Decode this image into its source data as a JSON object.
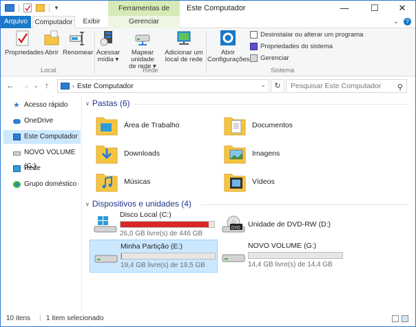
{
  "titlebar": {
    "context_tab": "Ferramentas de Unidade",
    "title": "Este Computador",
    "minimize": "—",
    "maximize": "☐",
    "close": "✕"
  },
  "tabs": {
    "file": "Arquivo",
    "computer": "Computador",
    "view": "Exibir",
    "manage": "Gerenciar"
  },
  "ribbon": {
    "local": {
      "label": "Local",
      "properties": "Propriedades",
      "open": "Abrir",
      "rename": "Renomear"
    },
    "network": {
      "label": "Rede",
      "access_media_1": "Acessar",
      "access_media_2": "mídia ▾",
      "map_drive_1": "Mapear unidade",
      "map_drive_2": "de rede ▾",
      "add_location_1": "Adicionar um",
      "add_location_2": "local de rede"
    },
    "system": {
      "label": "Sistema",
      "open_settings_1": "Abrir",
      "open_settings_2": "Configurações",
      "uninstall": "Desinstalar ou alterar um programa",
      "system_props": "Propriedades do sistema",
      "manage": "Gerenciar"
    }
  },
  "address": {
    "path": "Este Computador",
    "search_placeholder": "Pesquisar Este Computador"
  },
  "navpane": {
    "items": [
      {
        "label": "Acesso rápido",
        "icon": "star-icon"
      },
      {
        "label": "OneDrive",
        "icon": "cloud-icon"
      },
      {
        "label": "Este Computador",
        "icon": "computer-icon"
      },
      {
        "label": "NOVO VOLUME (G:)",
        "icon": "drive-icon"
      },
      {
        "label": "Rede",
        "icon": "network-icon"
      },
      {
        "label": "Grupo doméstico",
        "icon": "homegroup-icon"
      }
    ]
  },
  "folders": {
    "header": "Pastas (6)",
    "items": [
      {
        "label": "Área de Trabalho",
        "icon": "desktop-folder-icon"
      },
      {
        "label": "Documentos",
        "icon": "documents-folder-icon"
      },
      {
        "label": "Downloads",
        "icon": "downloads-folder-icon"
      },
      {
        "label": "Imagens",
        "icon": "pictures-folder-icon"
      },
      {
        "label": "Músicas",
        "icon": "music-folder-icon"
      },
      {
        "label": "Vídeos",
        "icon": "videos-folder-icon"
      }
    ]
  },
  "devices": {
    "header": "Dispositivos e unidades (4)",
    "items": [
      {
        "name": "Disco Local (C:)",
        "free": "26,0 GB livre(s) de 446 GB",
        "used_fraction": 0.94,
        "bar_color": "#da2626"
      },
      {
        "name": "Unidade de DVD-RW (D:)",
        "free": "",
        "used_fraction": null,
        "bar_color": ""
      },
      {
        "name": "Minha Partição (E:)",
        "free": "19,4 GB livre(s) de 19,5 GB",
        "used_fraction": 0.005,
        "bar_color": "#26a0da"
      },
      {
        "name": "NOVO VOLUME (G:)",
        "free": "14,4 GB livre(s) de 14,4 GB",
        "used_fraction": 0.0,
        "bar_color": "#26a0da"
      }
    ]
  },
  "status": {
    "count": "10 itens",
    "selected": "1 item selecionado"
  },
  "colors": {
    "accent": "#1979ca",
    "selection": "#cce8ff",
    "context_tab": "#d6eab6"
  }
}
